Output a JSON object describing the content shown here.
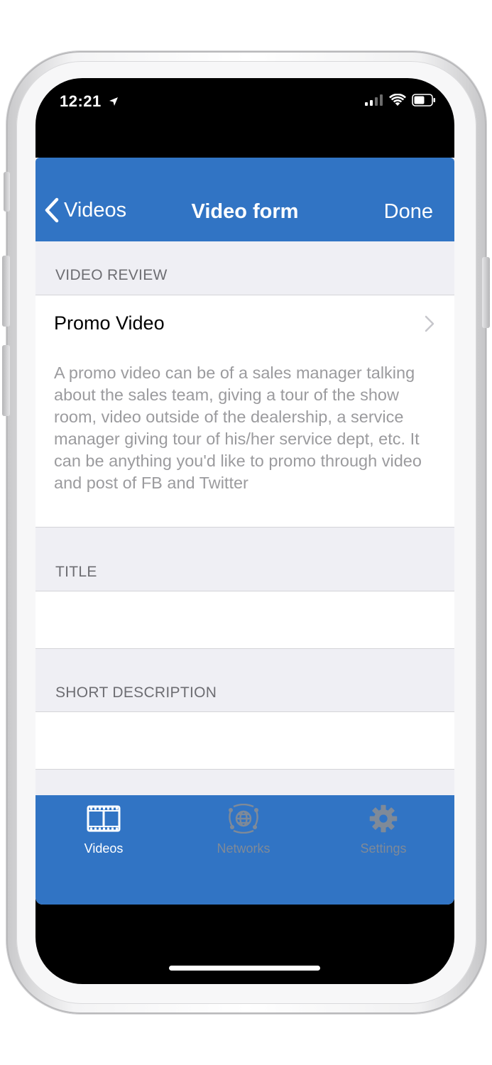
{
  "status_bar": {
    "time": "12:21",
    "icons": [
      "location-arrow-icon",
      "cellular-signal-icon",
      "wifi-icon",
      "battery-icon"
    ]
  },
  "nav": {
    "back_label": "Videos",
    "title": "Video form",
    "done_label": "Done"
  },
  "form": {
    "video_review_header": "VIDEO REVIEW",
    "selected_type": "Promo Video",
    "type_description": "A promo video can be of a sales manager talking about the sales team, giving a tour of the show room, video outside of the dealership, a service manager giving tour of his/her service dept, etc.  It can be anything you'd like to promo through video and post of FB and Twitter",
    "title_header": "TITLE",
    "title_value": "",
    "short_description_header": "SHORT DESCRIPTION",
    "short_description_value": ""
  },
  "tabbar": {
    "tabs": [
      {
        "label": "Videos",
        "icon": "film-icon",
        "active": true
      },
      {
        "label": "Networks",
        "icon": "globe-network-icon",
        "active": false
      },
      {
        "label": "Settings",
        "icon": "gear-icon",
        "active": false
      }
    ]
  },
  "colors": {
    "brand_blue": "#3174c4",
    "grouped_background": "#efeff4",
    "section_header_text": "#6d6d72",
    "description_text": "#9b9b9e",
    "inactive_tab": "#7f8a98"
  }
}
